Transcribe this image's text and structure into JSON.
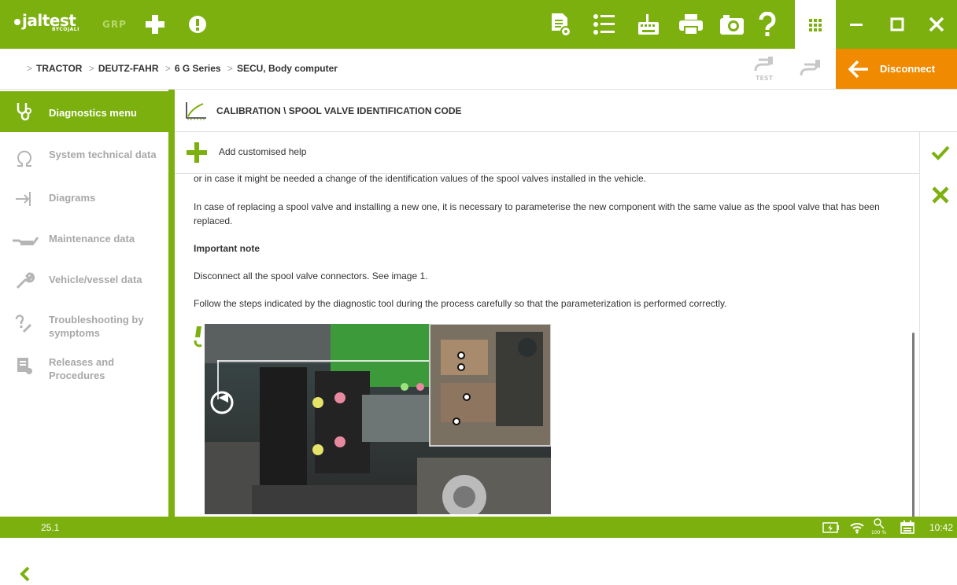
{
  "app": {
    "logo_text": "jaltest",
    "logo_sub": "BYCOJALI",
    "mode_label": "GRP"
  },
  "breadcrumb": [
    "TRACTOR",
    "DEUTZ-FAHR",
    "6 G Series",
    "SECU, Body computer"
  ],
  "connection": {
    "test_label": "TEST",
    "disconnect_label": "Disconnect"
  },
  "sidebar": {
    "items": [
      {
        "label": "Diagnostics menu",
        "icon": "stethoscope-icon",
        "active": true
      },
      {
        "label": "System technical data",
        "icon": "omega-icon",
        "active": false
      },
      {
        "label": "Diagrams",
        "icon": "diagram-arrow-icon",
        "active": false
      },
      {
        "label": "Maintenance data",
        "icon": "oil-can-icon",
        "active": false
      },
      {
        "label": "Vehicle/vessel data",
        "icon": "wrench-icon",
        "active": false
      },
      {
        "label": "Troubleshooting by symptoms",
        "icon": "question-wrench-icon",
        "active": false
      },
      {
        "label": "Releases and Procedures",
        "icon": "document-stack-icon",
        "active": false
      }
    ]
  },
  "page": {
    "title": "CALIBRATION \\ SPOOL VALVE IDENTIFICATION CODE",
    "add_help_label": "Add customised help"
  },
  "content": {
    "para_cut": "or in case it might be needed a change of the identification values of the spool valves installed in the vehicle.",
    "para_replace": "In case of replacing a spool valve and installing a new one, it is necessary to parameterise the new component with the same value as the spool valve that has been replaced.",
    "note_heading": "Important note",
    "para_disconnect": "Disconnect all the spool valve connectors. See image 1.",
    "para_steps": "Follow the steps indicated by the diagnostic tool during the process carefully so that the parameterization is performed correctly."
  },
  "status": {
    "version": "25.1",
    "zoom": "100 %",
    "time": "10:42"
  },
  "colors": {
    "brand_green": "#7cb00f",
    "disconnect_orange": "#f08a00"
  }
}
